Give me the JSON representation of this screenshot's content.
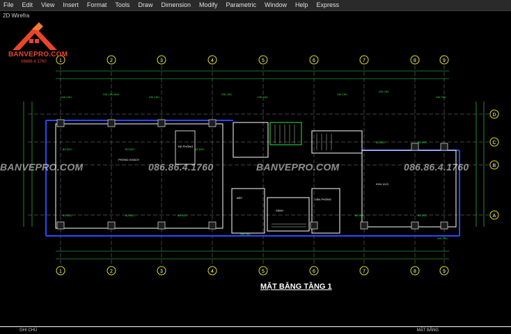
{
  "menubar": {
    "items": [
      "File",
      "Edit",
      "View",
      "Insert",
      "Format",
      "Tools",
      "Draw",
      "Dimension",
      "Modify",
      "Parametric",
      "Window",
      "Help",
      "Express"
    ]
  },
  "viewport": {
    "label": "2D Wirefra"
  },
  "logo": {
    "brand": "BANVEPRO.COM",
    "phone": "08686.4.1760"
  },
  "watermarks": [
    {
      "text": "BANVEPRO.COM"
    },
    {
      "text": "086.86.4.1760"
    },
    {
      "text": "BANVEPRO.COM"
    },
    {
      "text": "086.86.4.1760"
    }
  ],
  "drawing": {
    "title": "MẶT BẰNG TẦNG 1",
    "grid_numbers": [
      "1",
      "2",
      "3",
      "4",
      "5",
      "6",
      "7",
      "8",
      "9"
    ],
    "grid_letters": [
      "D",
      "C",
      "B",
      "A"
    ],
    "room_labels": [
      "ĐỂ PHÒNG",
      "PHÒNG KHÁCH",
      "SẢNH",
      "KHU VỰC",
      "BẾP",
      "VĂN PHÒNG"
    ]
  },
  "titleblock": {
    "note": "GHI CHÚ",
    "corner": "MẶT BẰNG"
  },
  "colors": {
    "background": "#000000",
    "accent_green": "#2ee84a",
    "accent_blue": "#2a49ff",
    "accent_yellow": "#e6e600",
    "logo": "#e8452c"
  }
}
